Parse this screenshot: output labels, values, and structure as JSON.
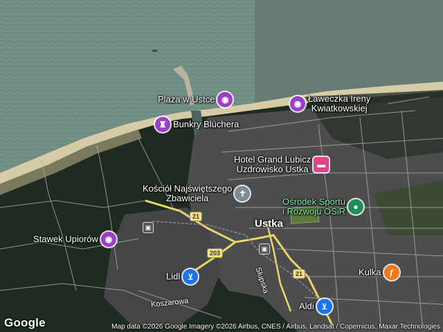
{
  "map": {
    "type": "satellite",
    "colors": {
      "sea": "#6f8c83",
      "beach": "#d7cca9",
      "forest": "#1e2a1e",
      "town": "#4e4e50",
      "road_major": "#e9d66a",
      "road_minor": "#b8b8b8"
    }
  },
  "places": {
    "town_name": "Ustka"
  },
  "pois": [
    {
      "id": "plaza",
      "label": "Plaża w Ustce",
      "icon": "camera-icon",
      "glyph": "◉",
      "color": "#9b3fc4"
    },
    {
      "id": "laweczka",
      "label_line1": "Ławeczka Ireny",
      "label_line2": "Kwiatkowskiej",
      "icon": "camera-icon",
      "glyph": "◉",
      "color": "#9b3fc4"
    },
    {
      "id": "bunkry",
      "label": "Bunkry Blüchera",
      "icon": "castle-icon",
      "glyph": "♜",
      "color": "#9b3fc4"
    },
    {
      "id": "hotel",
      "label_line1": "Hotel Grand Lubicz",
      "label_line2": "Uzdrowisko Ustka",
      "icon": "bed-icon",
      "glyph": "▬",
      "color": "#e0458a"
    },
    {
      "id": "kosciol",
      "label_line1": "Kościół Najświętszego",
      "label_line2": "Zbawiciela",
      "icon": "cross-icon",
      "glyph": "✝",
      "color": "#7d8b98"
    },
    {
      "id": "osrodek",
      "label_line1": "Ośrodek Sportu",
      "label_line2": "i Rozwoju OSiR",
      "icon": "location-pin-icon",
      "glyph": "●",
      "color": "#1e8f57"
    },
    {
      "id": "stawek",
      "label": "Stawek Upiorów",
      "icon": "camera-icon",
      "glyph": "◉",
      "color": "#9b3fc4"
    },
    {
      "id": "lidl",
      "label": "Lidl",
      "icon": "shopping-cart-icon",
      "glyph": "🛒",
      "color": "#1a73e8"
    },
    {
      "id": "aldi",
      "label": "Aldi",
      "icon": "shopping-cart-icon",
      "glyph": "🛒",
      "color": "#1a73e8"
    },
    {
      "id": "kulka",
      "label": "Kulka",
      "icon": "fork-knife-icon",
      "glyph": "🍴",
      "color": "#f07a1a"
    }
  ],
  "road_shields": [
    {
      "id": "r21a",
      "text": "21",
      "color": "#f4e27a"
    },
    {
      "id": "r21b",
      "text": "21",
      "color": "#f4e27a"
    },
    {
      "id": "r203",
      "text": "203",
      "color": "#f4e27a"
    }
  ],
  "streets": {
    "koszarowa": "Koszarowa",
    "slupska": "Słupska"
  },
  "footer": {
    "logo": "Google",
    "attribution": "Map data ©2026 Google Imagery ©2026 Airbus, CNES / Airbus, Landsat / Copernicus, Maxar Technologies"
  }
}
